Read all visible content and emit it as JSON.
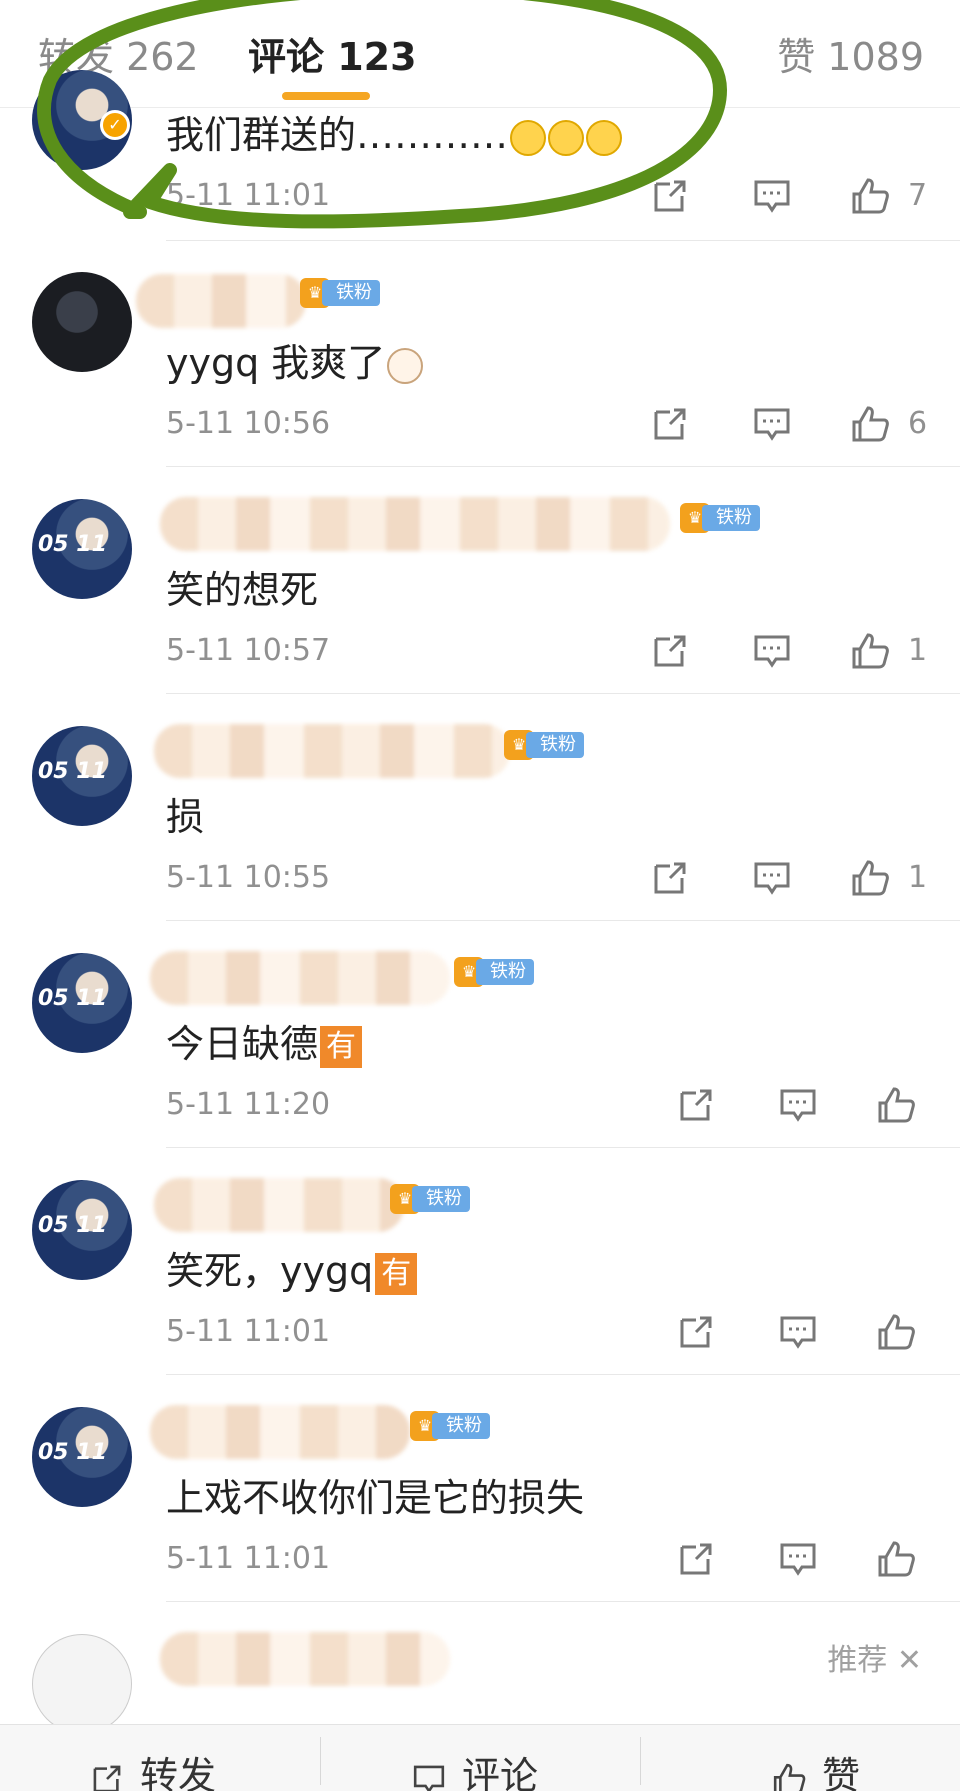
{
  "tabs": {
    "forward": "转发 262",
    "comments": "评论 123",
    "likes": "赞 1089"
  },
  "comments": [
    {
      "text": "我们群送的…………",
      "time": "5-11 11:01",
      "likes": "7"
    },
    {
      "text": "yygq 我爽了",
      "badge": "铁粉",
      "time": "5-11 10:56",
      "likes": "6"
    },
    {
      "text": "笑的想死",
      "badge": "铁粉",
      "time": "5-11 10:57",
      "likes": "1"
    },
    {
      "text": "损",
      "badge": "铁粉",
      "time": "5-11 10:55",
      "likes": "1"
    },
    {
      "text": "今日缺德",
      "tag": "有",
      "badge": "铁粉",
      "time": "5-11 11:20",
      "likes": ""
    },
    {
      "text": "笑死，yygq",
      "tag": "有",
      "badge": "铁粉",
      "time": "5-11 11:01",
      "likes": ""
    },
    {
      "text": "上戏不收你们是它的损失",
      "badge": "铁粉",
      "time": "5-11 11:01",
      "likes": ""
    }
  ],
  "avatar_badge": "05 11",
  "recommend": "推荐 ✕",
  "bottombar": {
    "forward": "转发",
    "comment": "评论",
    "like": "赞"
  },
  "colors": {
    "accent": "#f5a623",
    "annotation": "#5a8f1a",
    "fan_badge": "#6aa9e6"
  },
  "icons": [
    "share-icon",
    "comment-icon",
    "thumbs-up-icon",
    "verified-icon",
    "crown-icon",
    "close-icon"
  ]
}
